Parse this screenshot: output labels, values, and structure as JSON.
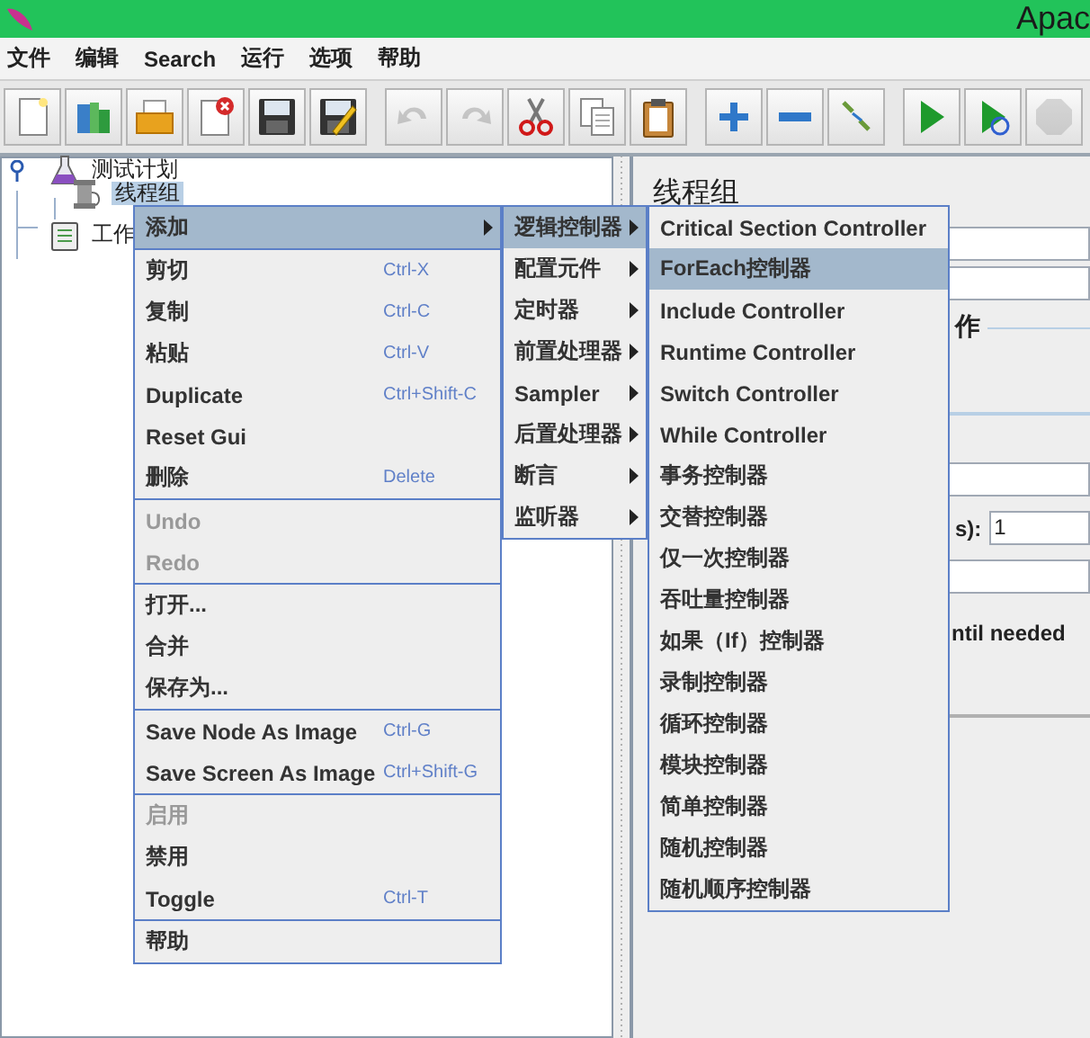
{
  "window": {
    "title": "Apac"
  },
  "menu_bar": [
    "文件",
    "编辑",
    "Search",
    "运行",
    "选项",
    "帮助"
  ],
  "toolbar": [
    [
      {
        "kind": "new",
        "disabled": false
      },
      {
        "kind": "templates",
        "disabled": false
      },
      {
        "kind": "open",
        "disabled": false
      },
      {
        "kind": "close",
        "disabled": false
      },
      {
        "kind": "save",
        "disabled": false
      },
      {
        "kind": "save_as",
        "disabled": false
      }
    ],
    [
      {
        "kind": "undo",
        "disabled": true
      },
      {
        "kind": "redo",
        "disabled": true
      },
      {
        "kind": "cut",
        "disabled": false
      },
      {
        "kind": "copy",
        "disabled": false
      },
      {
        "kind": "paste",
        "disabled": false
      }
    ],
    [
      {
        "kind": "expand",
        "disabled": false
      },
      {
        "kind": "collapse",
        "disabled": false
      },
      {
        "kind": "toggle",
        "disabled": false
      }
    ],
    [
      {
        "kind": "start",
        "disabled": false
      },
      {
        "kind": "start_no_pause",
        "disabled": false
      },
      {
        "kind": "stop",
        "disabled": true
      }
    ]
  ],
  "tree": [
    {
      "label": "测试计划",
      "kind": "plan",
      "selected": false,
      "expanded": true,
      "children": [
        {
          "label": "线程组",
          "kind": "thread",
          "selected": true
        }
      ]
    },
    {
      "label": "工作",
      "kind": "workbench",
      "selected": false
    }
  ],
  "panel": {
    "title": "线程组",
    "group_label": "作",
    "field_label": "s):",
    "field_value": "1",
    "checkbox_label": "ntil needed"
  },
  "context_menu": {
    "groups": [
      [
        {
          "label": "添加",
          "selected": true,
          "disabled": false,
          "submenu": true
        }
      ],
      [
        {
          "label": "剪切",
          "shortcut": "Ctrl-X",
          "selected": false,
          "disabled": false,
          "submenu": false
        },
        {
          "label": "复制",
          "shortcut": "Ctrl-C",
          "selected": false,
          "disabled": false,
          "submenu": false
        },
        {
          "label": "粘贴",
          "shortcut": "Ctrl-V",
          "selected": false,
          "disabled": false,
          "submenu": false
        },
        {
          "label": "Duplicate",
          "shortcut": "Ctrl+Shift-C",
          "selected": false,
          "disabled": false,
          "submenu": false
        },
        {
          "label": "Reset Gui",
          "selected": false,
          "disabled": false,
          "submenu": false
        },
        {
          "label": "删除",
          "shortcut": "Delete",
          "selected": false,
          "disabled": false,
          "submenu": false
        }
      ],
      [
        {
          "label": "Undo",
          "selected": false,
          "disabled": true,
          "submenu": false
        },
        {
          "label": "Redo",
          "selected": false,
          "disabled": true,
          "submenu": false
        }
      ],
      [
        {
          "label": "打开...",
          "selected": false,
          "disabled": false,
          "submenu": false
        },
        {
          "label": "合并",
          "selected": false,
          "disabled": false,
          "submenu": false
        },
        {
          "label": "保存为...",
          "selected": false,
          "disabled": false,
          "submenu": false
        }
      ],
      [
        {
          "label": "Save Node As Image",
          "shortcut": "Ctrl-G",
          "selected": false,
          "disabled": false,
          "submenu": false
        },
        {
          "label": "Save Screen As Image",
          "shortcut": "Ctrl+Shift-G",
          "selected": false,
          "disabled": false,
          "submenu": false
        }
      ],
      [
        {
          "label": "启用",
          "selected": false,
          "disabled": true,
          "submenu": false
        },
        {
          "label": "禁用",
          "selected": false,
          "disabled": false,
          "submenu": false
        },
        {
          "label": "Toggle",
          "shortcut": "Ctrl-T",
          "selected": false,
          "disabled": false,
          "submenu": false
        }
      ],
      [
        {
          "label": "帮助",
          "selected": false,
          "disabled": false,
          "submenu": false
        }
      ]
    ]
  },
  "add_submenu": {
    "items": [
      {
        "label": "逻辑控制器",
        "selected": true,
        "submenu": true
      },
      {
        "label": "配置元件",
        "selected": false,
        "submenu": true
      },
      {
        "label": "定时器",
        "selected": false,
        "submenu": true
      },
      {
        "label": "前置处理器",
        "selected": false,
        "submenu": true
      },
      {
        "label": "Sampler",
        "selected": false,
        "submenu": true
      },
      {
        "label": "后置处理器",
        "selected": false,
        "submenu": true
      },
      {
        "label": "断言",
        "selected": false,
        "submenu": true
      },
      {
        "label": "监听器",
        "selected": false,
        "submenu": true
      }
    ]
  },
  "logic_controller_submenu": {
    "items": [
      {
        "label": "Critical Section Controller",
        "selected": false
      },
      {
        "label": "ForEach控制器",
        "selected": true
      },
      {
        "label": "Include Controller",
        "selected": false
      },
      {
        "label": "Runtime Controller",
        "selected": false
      },
      {
        "label": "Switch Controller",
        "selected": false
      },
      {
        "label": "While Controller",
        "selected": false
      },
      {
        "label": "事务控制器",
        "selected": false
      },
      {
        "label": "交替控制器",
        "selected": false
      },
      {
        "label": "仅一次控制器",
        "selected": false
      },
      {
        "label": "吞吐量控制器",
        "selected": false
      },
      {
        "label": "如果（If）控制器",
        "selected": false
      },
      {
        "label": "录制控制器",
        "selected": false
      },
      {
        "label": "循环控制器",
        "selected": false
      },
      {
        "label": "模块控制器",
        "selected": false
      },
      {
        "label": "简单控制器",
        "selected": false
      },
      {
        "label": "随机控制器",
        "selected": false
      },
      {
        "label": "随机顺序控制器",
        "selected": false
      }
    ]
  }
}
